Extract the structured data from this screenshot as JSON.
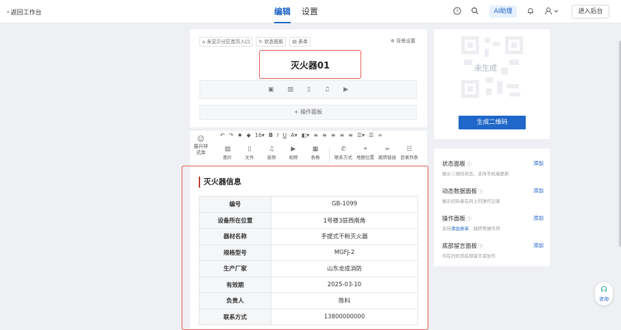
{
  "topbar": {
    "back_label": "返回工作台",
    "tabs": [
      {
        "label": "编辑",
        "active": true
      },
      {
        "label": "设置",
        "active": false
      }
    ],
    "ai_label": "AI助理",
    "enter_label": "进入后台"
  },
  "editor": {
    "chips": [
      "未显示分区首页入口",
      "状态面板",
      "表单"
    ],
    "bg_setting": "背景设置",
    "title": "灭火器01",
    "op_panel": "+ 操作面板",
    "toolbar": {
      "lib_label": "展开样式库",
      "font_size": "16",
      "inserts_a": [
        "图片",
        "文件",
        "音频",
        "视频",
        "表格"
      ],
      "inserts_b": [
        "联系方式",
        "地图位置",
        "跳转链接",
        "目录列表"
      ]
    }
  },
  "info": {
    "title": "灭火器信息",
    "rows": [
      {
        "k": "编号",
        "v": "GB-1099"
      },
      {
        "k": "设备所在位置",
        "v": "1号楼3层西南角"
      },
      {
        "k": "器材名称",
        "v": "手提式干粉灭火器"
      },
      {
        "k": "规格型号",
        "v": "MGFJ-2"
      },
      {
        "k": "生产厂家",
        "v": "山东龙成消防"
      },
      {
        "k": "有效期",
        "v": "2025-03-10"
      },
      {
        "k": "负责人",
        "v": "陈科"
      },
      {
        "k": "联系方式",
        "v": "13800000000"
      }
    ]
  },
  "qr": {
    "overlay": "未生成",
    "button": "生成二维码"
  },
  "modules": [
    {
      "name": "状态面板",
      "desc": "展示二维码状态，支持手机端更新",
      "add": "添加"
    },
    {
      "name": "动态数据面板",
      "desc": "展示扫码者在码上的操作记录",
      "add": "添加"
    },
    {
      "name": "操作面板",
      "desc_pre": "支持",
      "desc_link": "添加表单",
      "desc_post": "、跳转等操作项",
      "add": "添加"
    },
    {
      "name": "底部留言面板",
      "desc": "可在扫码页底部留言或协作",
      "add": "添加"
    }
  ],
  "consult_label": "咨询",
  "colors": {
    "accent": "#1f67c8",
    "highlight": "#e2584e"
  }
}
